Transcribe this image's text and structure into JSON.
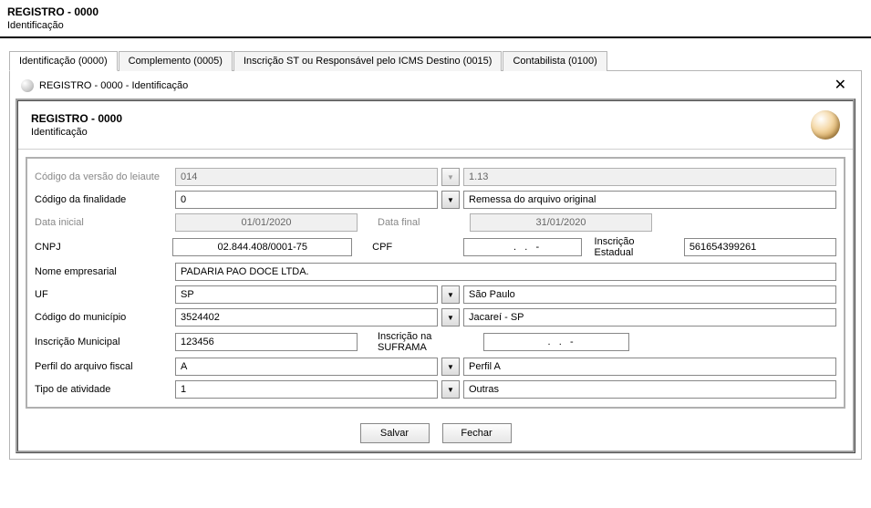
{
  "top": {
    "title": "REGISTRO - 0000",
    "subtitle": "Identificação"
  },
  "tabs": [
    {
      "label": "Identificação (0000)"
    },
    {
      "label": "Complemento (0005)"
    },
    {
      "label": "Inscrição ST ou Responsável pelo ICMS Destino (0015)"
    },
    {
      "label": "Contabilista (0100)"
    }
  ],
  "modal": {
    "title": "REGISTRO - 0000 - Identificação",
    "section_title": "REGISTRO - 0000",
    "section_subtitle": "Identificação"
  },
  "form": {
    "version_label": "Código da versão do leiaute",
    "version_code": "014",
    "version_desc": "1.13",
    "purpose_label": "Código da finalidade",
    "purpose_code": "0",
    "purpose_desc": "Remessa do arquivo original",
    "date_start_label": "Data inicial",
    "date_start": "01/01/2020",
    "date_end_label": "Data final",
    "date_end": "31/01/2020",
    "cnpj_label": "CNPJ",
    "cnpj": "02.844.408/0001-75",
    "cpf_label": "CPF",
    "cpf": "   .   .   -",
    "ie_label": "Inscrição Estadual",
    "ie": "561654399261",
    "company_label": "Nome empresarial",
    "company": "PADARIA PAO DOCE LTDA.",
    "uf_label": "UF",
    "uf_code": "SP",
    "uf_desc": "São Paulo",
    "city_label": "Código do município",
    "city_code": "3524402",
    "city_desc": "Jacareí - SP",
    "municipal_label": "Inscrição Municipal",
    "municipal": "123456",
    "suframa_label": "Inscrição na SUFRAMA",
    "suframa": "   .   .   -",
    "profile_label": "Perfil do arquivo fiscal",
    "profile_code": "A",
    "profile_desc": "Perfil A",
    "activity_label": "Tipo de atividade",
    "activity_code": "1",
    "activity_desc": "Outras"
  },
  "buttons": {
    "save": "Salvar",
    "close": "Fechar"
  }
}
